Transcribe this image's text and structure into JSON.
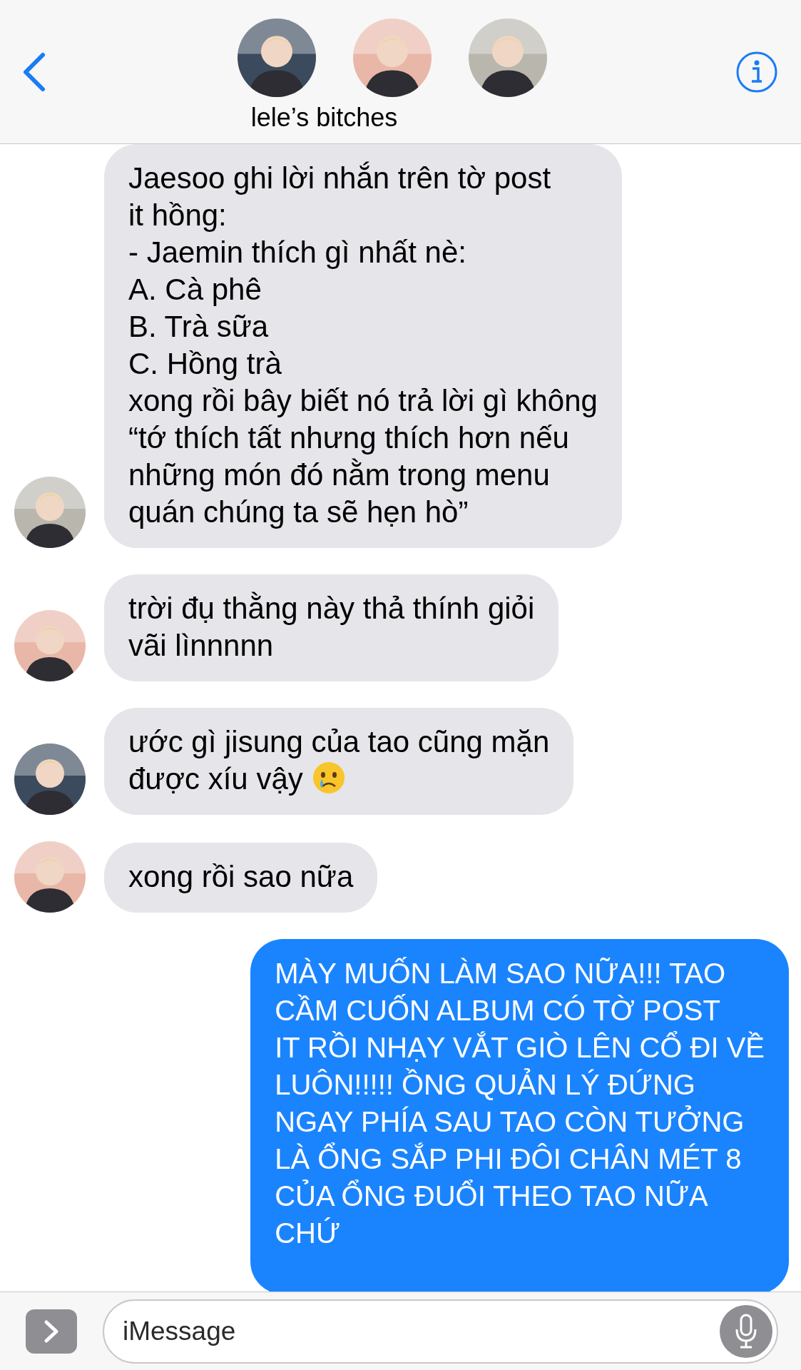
{
  "header": {
    "members": [
      {
        "color": "#3b4a5c"
      },
      {
        "color": "#e9b7a8"
      },
      {
        "color": "#b9b6ae"
      }
    ],
    "title": "lele’s bitches"
  },
  "messages": [
    {
      "kind": "incoming",
      "color": "#b9b6ae",
      "text": "Jaesoo ghi lời nhắn trên tờ post\nit hồng:\n- Jaemin thích gì nhất nè:\nA. Cà phê\nB. Trà sữa\nC. Hồng trà\nxong rồi bây biết nó trả lời gì không\n“tớ thích tất nhưng thích hơn nếu\nnhững món đó nằm trong menu\nquán chúng ta sẽ hẹn hò”"
    },
    {
      "kind": "incoming",
      "color": "#e9b7a8",
      "text": "trời đụ thằng này thả thính giỏi\nvãi lìnnnnn"
    },
    {
      "kind": "incoming",
      "color": "#3b4a5c",
      "text": "ước gì jisung của tao cũng mặn\nđược xíu vậy",
      "trailing_emoji": true
    },
    {
      "kind": "incoming",
      "color": "#e9b7a8",
      "text": "xong rồi sao nữa"
    },
    {
      "kind": "outgoing",
      "text": "MÀY MUỐN LÀM SAO NỮA!!! TAO\nCẦM CUỐN ALBUM CÓ TỜ POST\nIT RỒI NHẠY VẮT GIÒ LÊN CỔ ĐI VỀ\nLUÔN!!!!! ỒNG QUẢN LÝ ĐỨNG\nNGAY PHÍA SAU TAO CÒN TƯỞNG\nLÀ ỔNG SẮP PHI ĐÔI CHÂN MÉT 8\nCỦA ỔNG ĐUỔI THEO TAO NỮA\nCHỨ"
    }
  ],
  "composer": {
    "placeholder": "iMessage"
  }
}
